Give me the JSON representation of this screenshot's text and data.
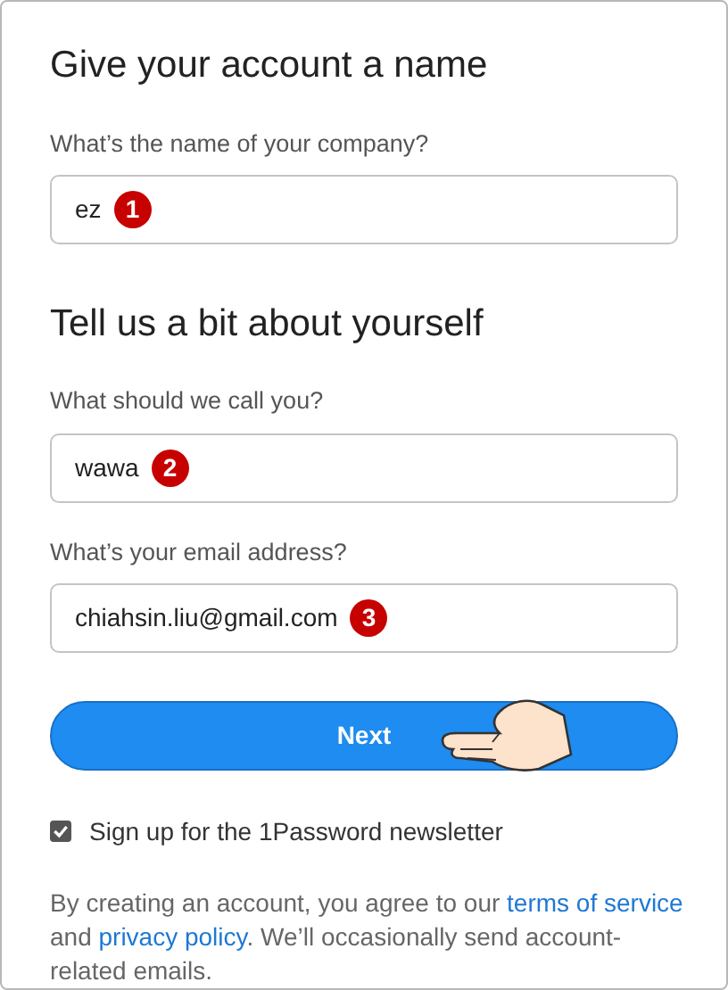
{
  "sections": [
    {
      "heading": "Give your account a name",
      "fields": [
        {
          "label": "What’s the name of your company?",
          "value": "ez",
          "badge": "1"
        }
      ]
    },
    {
      "heading": "Tell us a bit about yourself",
      "fields": [
        {
          "label": "What should we call you?",
          "value": "wawa",
          "badge": "2"
        },
        {
          "label": "What’s your email address?",
          "value": "chiahsin.liu@gmail.com",
          "badge": "3"
        }
      ]
    }
  ],
  "next_button": "Next",
  "newsletter": {
    "label": "Sign up for the 1Password newsletter",
    "checked": true
  },
  "legal": {
    "before": "By creating an account, you agree to our",
    "link_1": "terms of service",
    "and": "and",
    "link_2": "privacy policy",
    "after": ". We’ll occasionally send account-related emails."
  }
}
